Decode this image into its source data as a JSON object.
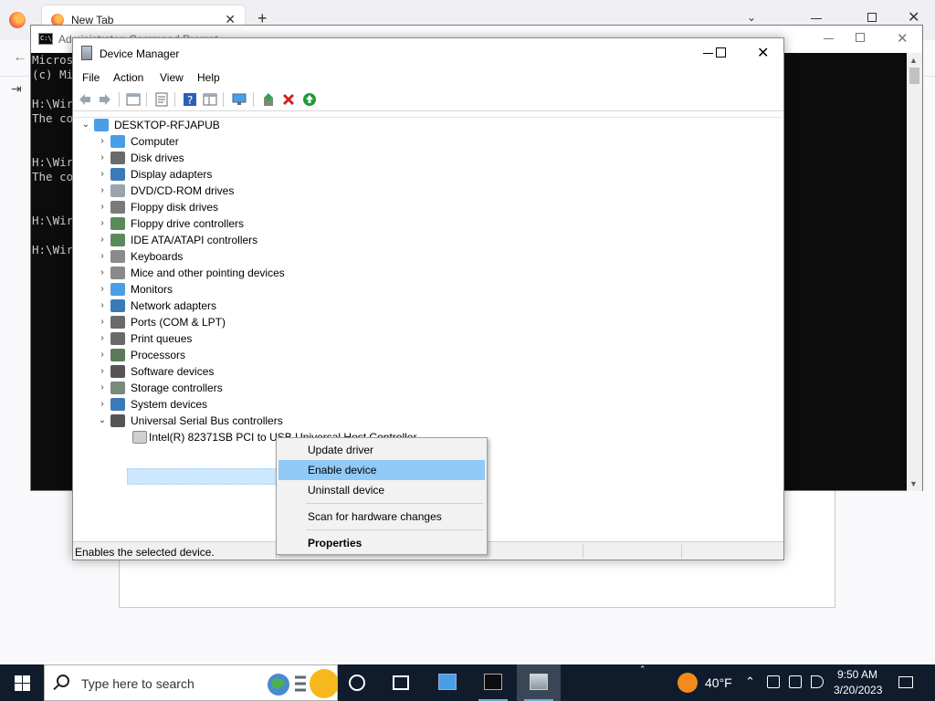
{
  "firefox": {
    "tab_title": "New Tab",
    "tab_close": "✕",
    "new_tab": "+",
    "list_all": "⌄",
    "close": "✕",
    "back": "←",
    "signin": "⇥"
  },
  "cmd": {
    "title": "Administrator: Command Prompt",
    "icon_text": "C:\\_",
    "close": "✕",
    "lines": [
      "Micros",
      "(c) Mi",
      "",
      "H:\\Wir",
      "The co",
      "",
      "",
      "H:\\Wir",
      "The co",
      "",
      "",
      "H:\\Wir",
      "",
      "H:\\Wir"
    ]
  },
  "dm": {
    "title": "Device Manager",
    "close": "✕",
    "menu": [
      "File",
      "Action",
      "View",
      "Help"
    ],
    "root": "DESKTOP-RFJAPUB",
    "nodes": [
      {
        "label": "Computer",
        "color": "#4a9ee8"
      },
      {
        "label": "Disk drives",
        "color": "#6a6a6a"
      },
      {
        "label": "Display adapters",
        "color": "#3a7ab8"
      },
      {
        "label": "DVD/CD-ROM drives",
        "color": "#9aa4ae"
      },
      {
        "label": "Floppy disk drives",
        "color": "#7a7a7a"
      },
      {
        "label": "Floppy drive controllers",
        "color": "#5a8a5a"
      },
      {
        "label": "IDE ATA/ATAPI controllers",
        "color": "#5a8a5a"
      },
      {
        "label": "Keyboards",
        "color": "#8a8a8a"
      },
      {
        "label": "Mice and other pointing devices",
        "color": "#8a8a8a"
      },
      {
        "label": "Monitors",
        "color": "#4a9ee8"
      },
      {
        "label": "Network adapters",
        "color": "#3a7ab8"
      },
      {
        "label": "Ports (COM & LPT)",
        "color": "#6a6a6a"
      },
      {
        "label": "Print queues",
        "color": "#6a6a6a"
      },
      {
        "label": "Processors",
        "color": "#5a7a5a"
      },
      {
        "label": "Software devices",
        "color": "#555555"
      },
      {
        "label": "Storage controllers",
        "color": "#7a8a7a"
      },
      {
        "label": "System devices",
        "color": "#3a7ab8"
      },
      {
        "label": "Universal Serial Bus controllers",
        "color": "#555555"
      }
    ],
    "usb_child": "Intel(R) 82371SB PCI to USB Universal Host Controller",
    "status": "Enables the selected device.",
    "chev_right": "›",
    "chev_down": "⌄"
  },
  "context_menu": {
    "items": [
      "Update driver",
      "Enable device",
      "Uninstall device",
      "Scan for hardware changes",
      "Properties"
    ],
    "highlighted": "Enable device",
    "highlight_color": "#91c9f7"
  },
  "taskbar": {
    "search_placeholder": "Type here to search",
    "weather_temp": "40°F",
    "time": "9:50 AM",
    "date": "3/20/2023",
    "tray_up": "⌃",
    "tray_chevron": "⌃"
  }
}
